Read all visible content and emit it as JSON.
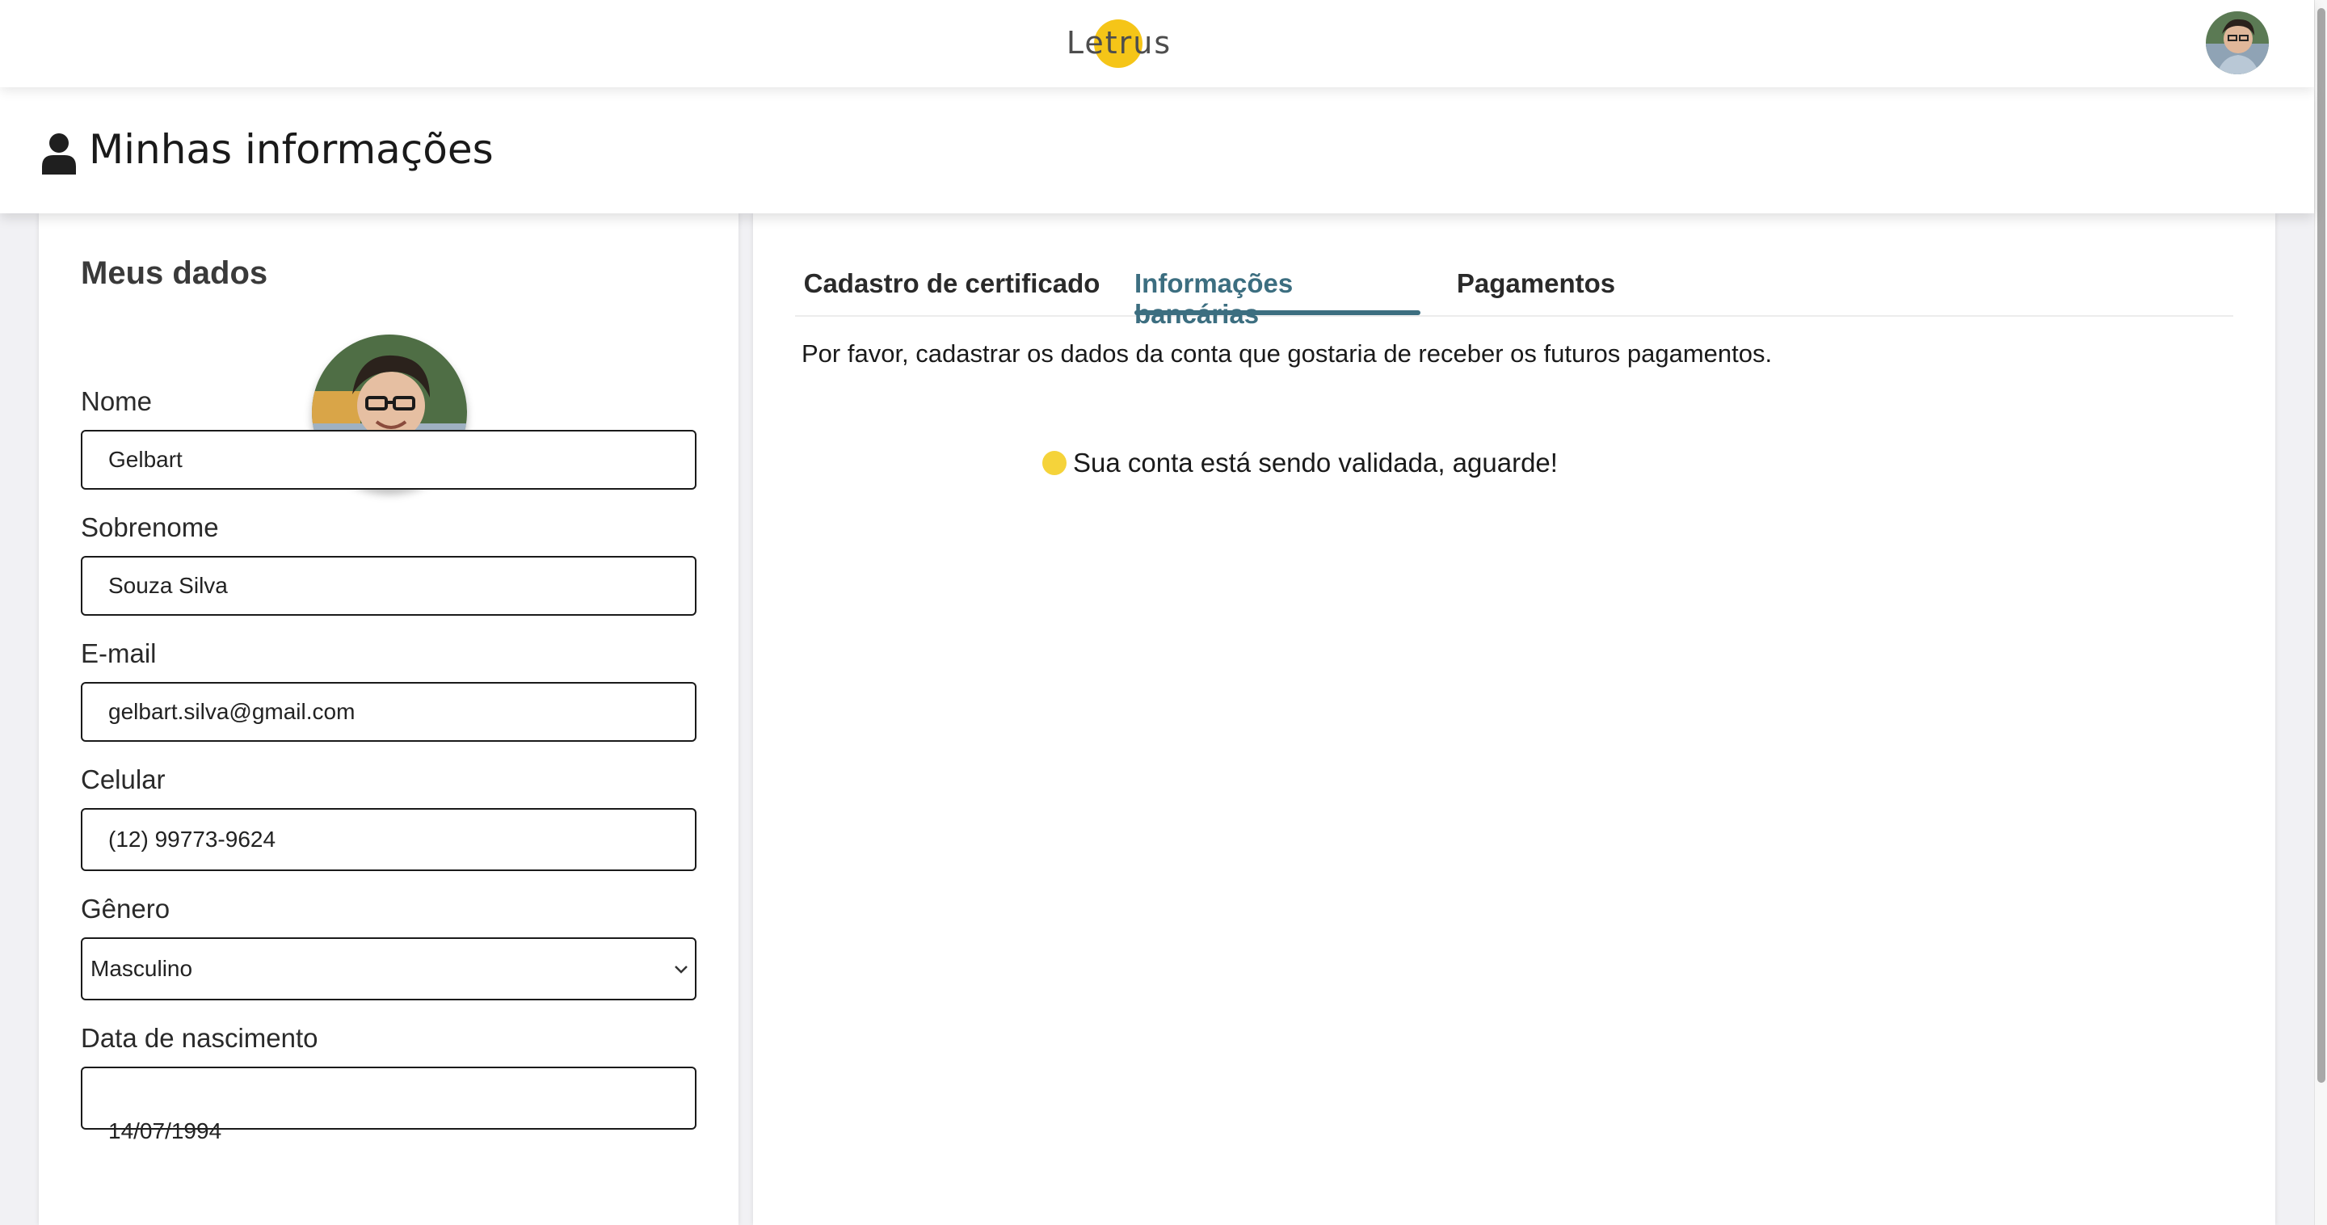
{
  "brand": {
    "logo_text": "Letrus"
  },
  "header": {
    "title": "Minhas informações"
  },
  "profile": {
    "card_title": "Meus dados",
    "fields": {
      "nome": {
        "label": "Nome",
        "value": "Gelbart"
      },
      "sobrenome": {
        "label": "Sobrenome",
        "value": "Souza Silva"
      },
      "email": {
        "label": "E-mail",
        "value": "gelbart.silva@gmail.com"
      },
      "celular": {
        "label": "Celular",
        "value": "(12) 99773-9624"
      },
      "genero": {
        "label": "Gênero",
        "value": "Masculino"
      },
      "nascimento": {
        "label": "Data de nascimento",
        "value": "14/07/1994"
      }
    }
  },
  "tabs": [
    {
      "label": "Cadastro de certificado"
    },
    {
      "label": "Informações bancárias"
    },
    {
      "label": "Pagamentos"
    }
  ],
  "bank": {
    "instruction": "Por favor, cadastrar os dados da conta que gostaria de receber os futuros pagamentos.",
    "status_text": "Sua conta está sendo validada, aguarde!"
  },
  "colors": {
    "accent": "#3c6e80",
    "status_pending": "#f5d33a",
    "logo_sun": "#f5c518"
  },
  "icons": [
    "person-icon",
    "chevron-down-icon",
    "status-dot-icon"
  ]
}
